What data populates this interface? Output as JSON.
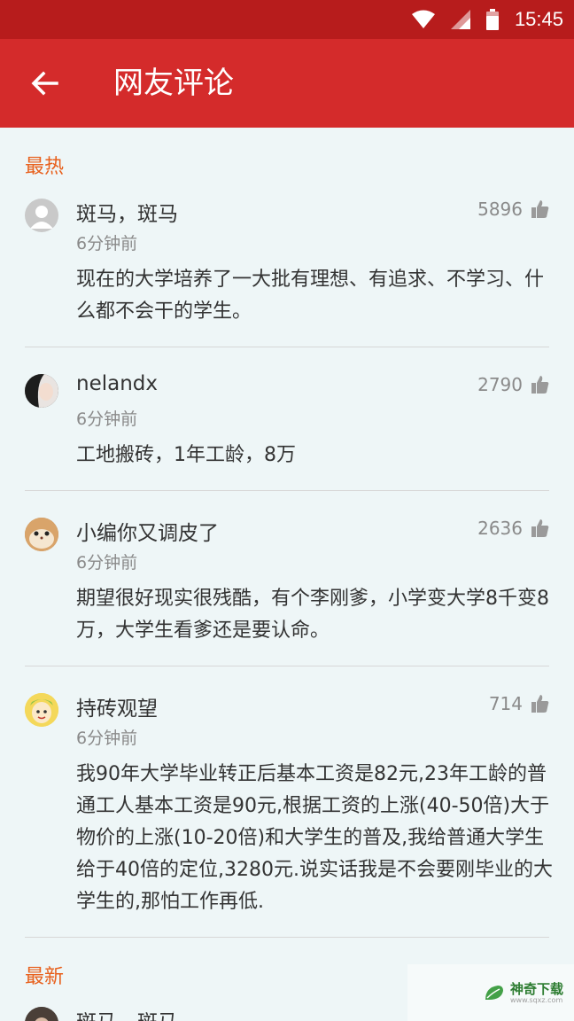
{
  "status_bar": {
    "time": "15:45"
  },
  "app_bar": {
    "title": "网友评论"
  },
  "sections": {
    "hot": "最热",
    "new": "最新"
  },
  "comments": [
    {
      "name": "斑马，斑马",
      "time": "6分钟前",
      "likes": "5896",
      "text": "现在的大学培养了一大批有理想、有追求、不学习、什么都不会干的学生。"
    },
    {
      "name": "nelandx",
      "time": "6分钟前",
      "likes": "2790",
      "text": "工地搬砖，1年工龄，8万"
    },
    {
      "name": "小编你又调皮了",
      "time": "6分钟前",
      "likes": "2636",
      "text": "期望很好现实很残酷，有个李刚爹，小学变大学8千变8万，大学生看爹还是要认命。"
    },
    {
      "name": "持砖观望",
      "time": "6分钟前",
      "likes": "714",
      "text": "我90年大学毕业转正后基本工资是82元,23年工龄的普通工人基本工资是90元,根据工资的上涨(40-50倍)大于物价的上涨(10-20倍)和大学生的普及,我给普通大学生给于40倍的定位,3280元.说实话我是不会要刚毕业的大学生的,那怕工作再低."
    },
    {
      "name": "斑马，斑马"
    }
  ],
  "watermark": {
    "title": "神奇下载",
    "url": "www.sqxz.com"
  },
  "colors": {
    "status_bar": "#b71c1c",
    "app_bar": "#d42b2b",
    "section_accent": "#e8601c",
    "background": "#eef6f7"
  },
  "icons": {
    "back": "arrow-left-icon",
    "like": "thumbs-up-icon",
    "wifi": "wifi-icon",
    "signal": "signal-icon",
    "battery": "battery-icon"
  }
}
